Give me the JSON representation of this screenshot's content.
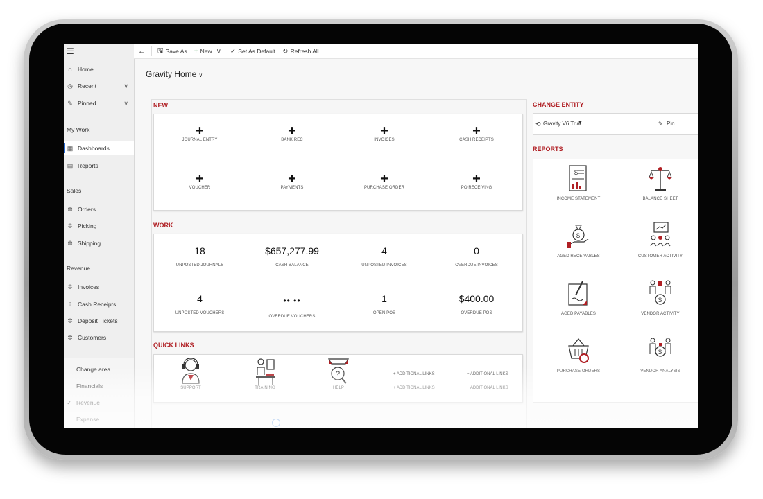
{
  "toolbar": {
    "save_as": "Save As",
    "new": "New",
    "set_default": "Set As Default",
    "refresh": "Refresh All"
  },
  "sidebar": {
    "items": [
      {
        "label": "Home"
      },
      {
        "label": "Recent"
      },
      {
        "label": "Pinned"
      }
    ],
    "my_work_header": "My Work",
    "my_work": [
      {
        "label": "Dashboards"
      },
      {
        "label": "Reports"
      }
    ],
    "sales_header": "Sales",
    "sales": [
      {
        "label": "Orders"
      },
      {
        "label": "Picking"
      },
      {
        "label": "Shipping"
      }
    ],
    "revenue_header": "Revenue",
    "revenue": [
      {
        "label": "Invoices"
      },
      {
        "label": "Cash Receipts"
      },
      {
        "label": "Deposit Tickets"
      },
      {
        "label": "Customers"
      }
    ],
    "change_area": {
      "title": "Change area",
      "options": [
        "Financials",
        "Revenue",
        "Expense"
      ]
    }
  },
  "page": {
    "title": "Gravity Home"
  },
  "new_section": {
    "label": "NEW",
    "tiles": [
      "JOURNAL ENTRY",
      "BANK REC",
      "INVOICES",
      "CASH RECEIPTS",
      "VOUCHER",
      "PAYMENTS",
      "PURCHASE ORDER",
      "PO RECEIVING"
    ]
  },
  "work_section": {
    "label": "WORK",
    "tiles": [
      {
        "value": "18",
        "label": "UNPOSTED JOURNALS"
      },
      {
        "value": "$657,277.99",
        "label": "CASH BALANCE"
      },
      {
        "value": "4",
        "label": "UNPOSTED INVOICES"
      },
      {
        "value": "0",
        "label": "OVERDUE INVOICES"
      },
      {
        "value": "4",
        "label": "UNPOSTED VOUCHERS"
      },
      {
        "value": "•• ••",
        "label": "OVERDUE VOUCHERS"
      },
      {
        "value": "1",
        "label": "OPEN POS"
      },
      {
        "value": "$400.00",
        "label": "OVERDUE POS"
      }
    ]
  },
  "quick_links": {
    "label": "QUICK LINKS",
    "items": [
      "SUPPORT",
      "TRAINING",
      "HELP"
    ],
    "additional": [
      "+ ADDITIONAL LINKS",
      "+ ADDITIONAL LINKS",
      "+ ADDITIONAL LINKS",
      "+ ADDITIONAL LINKS"
    ]
  },
  "change_entity": {
    "label": "CHANGE ENTITY",
    "entity": "Gravity V6 Trial",
    "pin": "Pin"
  },
  "reports": {
    "label": "REPORTS",
    "items": [
      "INCOME STATEMENT",
      "BALANCE SHEET",
      "AGED RECEIVABLES",
      "CUSTOMER ACTIVITY",
      "AGED PAYABLES",
      "VENDOR ACTIVITY",
      "PURCHASE ORDERS",
      "VENDOR ANALYSIS"
    ]
  },
  "colors": {
    "accent": "#b01f24",
    "link_blue": "#3f84d8"
  },
  "icons": [
    "hamburger-icon",
    "home-icon",
    "clock-icon",
    "pin-icon",
    "dashboard-icon",
    "report-icon",
    "gear-icon",
    "back-arrow-icon",
    "plus-icon",
    "check-icon",
    "refresh-icon"
  ]
}
